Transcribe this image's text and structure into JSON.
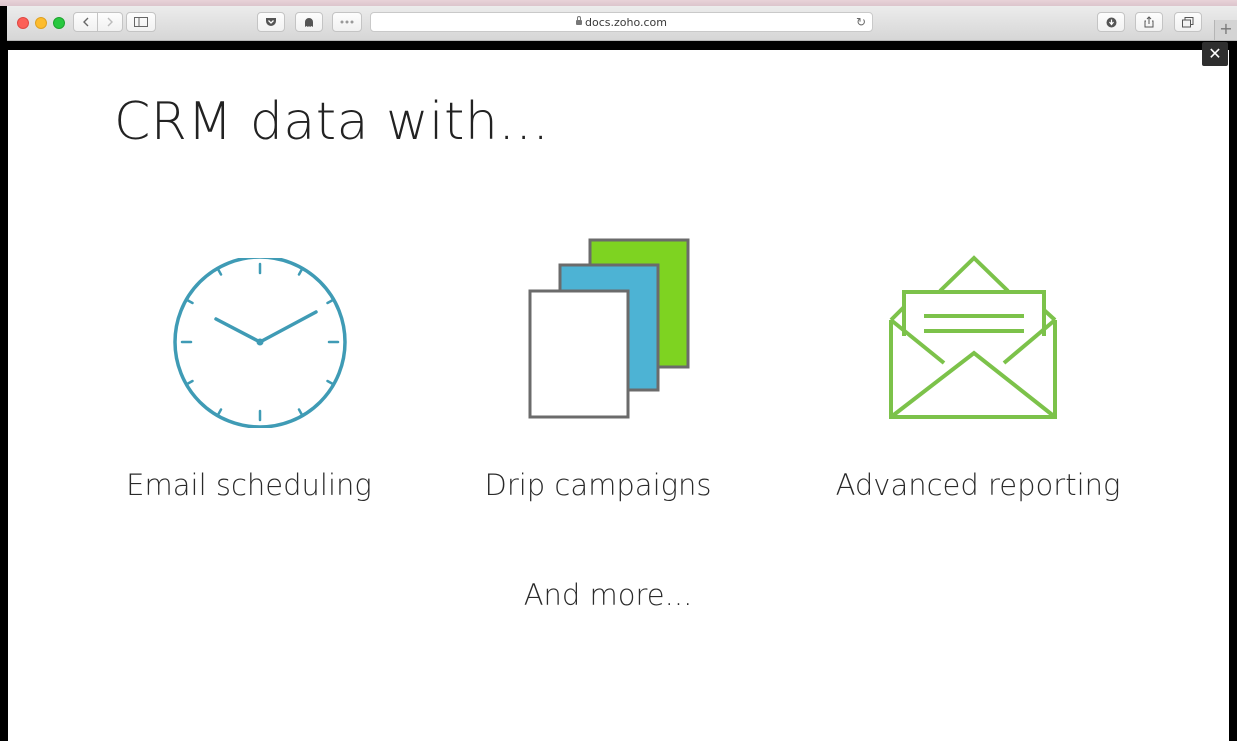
{
  "browser": {
    "url": "docs.zoho.com",
    "new_tab_symbol": "+"
  },
  "slide": {
    "close_symbol": "✕",
    "title": "CRM data with...",
    "features": [
      {
        "label": "Email scheduling",
        "icon": "clock-icon"
      },
      {
        "label": "Drip campaigns",
        "icon": "stacked-documents-icon"
      },
      {
        "label": "Advanced reporting",
        "icon": "open-envelope-icon"
      }
    ],
    "more_text": "And more..."
  },
  "colors": {
    "clock": "#3f9bb5",
    "doc_green": "#7ed321",
    "doc_blue": "#4db3d4",
    "doc_outline": "#6b6b6b",
    "envelope": "#7cc24a"
  }
}
